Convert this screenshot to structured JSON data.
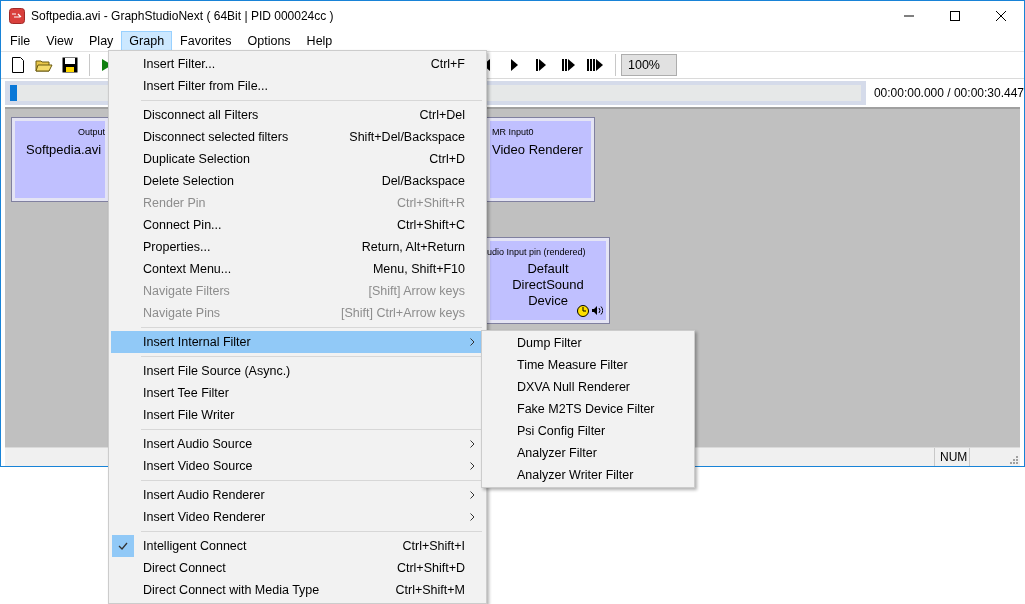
{
  "window": {
    "title": "Softpedia.avi - GraphStudioNext ( 64Bit | PID 000024cc )"
  },
  "menu_bar": [
    {
      "label": "File",
      "selected": false
    },
    {
      "label": "View",
      "selected": false
    },
    {
      "label": "Play",
      "selected": false
    },
    {
      "label": "Graph",
      "selected": true
    },
    {
      "label": "Favorites",
      "selected": false
    },
    {
      "label": "Options",
      "selected": false
    },
    {
      "label": "Help",
      "selected": false
    }
  ],
  "toolbar": {
    "zoom": "100%"
  },
  "seek_bar": {
    "level": 0.0,
    "time": "00:00:00.000 / 00:00:30.447"
  },
  "graph": {
    "filters": [
      {
        "kind": "source",
        "pin_label": "Output",
        "name": "Softpedia.avi",
        "clock": false
      },
      {
        "kind": "video",
        "pin_label": "MR Input0",
        "name": "Video Renderer",
        "clock": false
      },
      {
        "kind": "audio",
        "pin_label": "udio Input pin (rendered)",
        "name": "Default DirectSound Device",
        "clock": true
      }
    ]
  },
  "status_bar": {
    "num": "NUM"
  },
  "graph_menu": {
    "groups": [
      [
        {
          "label": "Insert Filter...",
          "shortcut": "Ctrl+F",
          "disabled": false,
          "checked": false,
          "selected": false,
          "submenu": false
        },
        {
          "label": "Insert Filter from File...",
          "disabled": false,
          "checked": false,
          "selected": false,
          "submenu": false
        }
      ],
      [
        {
          "label": "Disconnect all Filters",
          "shortcut": "Ctrl+Del",
          "disabled": false,
          "checked": false,
          "selected": false,
          "submenu": false
        },
        {
          "label": "Disconnect selected filters",
          "shortcut": "Shift+Del/Backspace",
          "disabled": false,
          "checked": false,
          "selected": false,
          "submenu": false
        },
        {
          "label": "Duplicate Selection",
          "shortcut": "Ctrl+D",
          "disabled": false,
          "checked": false,
          "selected": false,
          "submenu": false
        },
        {
          "label": "Delete Selection",
          "shortcut": "Del/Backspace",
          "disabled": false,
          "checked": false,
          "selected": false,
          "submenu": false
        },
        {
          "label": "Render Pin",
          "shortcut": "Ctrl+Shift+R",
          "disabled": true,
          "checked": false,
          "selected": false,
          "submenu": false
        },
        {
          "label": "Connect Pin...",
          "shortcut": "Ctrl+Shift+C",
          "disabled": false,
          "checked": false,
          "selected": false,
          "submenu": false
        },
        {
          "label": "Properties...",
          "shortcut": "Return, Alt+Return",
          "disabled": false,
          "checked": false,
          "selected": false,
          "submenu": false
        },
        {
          "label": "Context Menu...",
          "shortcut": "Menu, Shift+F10",
          "disabled": false,
          "checked": false,
          "selected": false,
          "submenu": false
        },
        {
          "label": "Navigate Filters",
          "shortcut": "[Shift] Arrow keys",
          "disabled": true,
          "checked": false,
          "selected": false,
          "submenu": false
        },
        {
          "label": "Navigate Pins",
          "shortcut": "[Shift] Ctrl+Arrow keys",
          "disabled": true,
          "checked": false,
          "selected": false,
          "submenu": false
        }
      ],
      [
        {
          "label": "Insert Internal Filter",
          "disabled": false,
          "checked": false,
          "selected": true,
          "submenu": true
        }
      ],
      [
        {
          "label": "Insert File Source (Async.)",
          "disabled": false,
          "checked": false,
          "selected": false,
          "submenu": false
        },
        {
          "label": "Insert Tee Filter",
          "disabled": false,
          "checked": false,
          "selected": false,
          "submenu": false
        },
        {
          "label": "Insert File Writer",
          "disabled": false,
          "checked": false,
          "selected": false,
          "submenu": false
        }
      ],
      [
        {
          "label": "Insert Audio Source",
          "disabled": false,
          "checked": false,
          "selected": false,
          "submenu": true
        },
        {
          "label": "Insert Video Source",
          "disabled": false,
          "checked": false,
          "selected": false,
          "submenu": true
        }
      ],
      [
        {
          "label": "Insert Audio Renderer",
          "disabled": false,
          "checked": false,
          "selected": false,
          "submenu": true
        },
        {
          "label": "Insert Video Renderer",
          "disabled": false,
          "checked": false,
          "selected": false,
          "submenu": true
        }
      ],
      [
        {
          "label": "Intelligent Connect",
          "shortcut": "Ctrl+Shift+I",
          "disabled": false,
          "checked": true,
          "selected": false,
          "submenu": false
        },
        {
          "label": "Direct Connect",
          "shortcut": "Ctrl+Shift+D",
          "disabled": false,
          "checked": false,
          "selected": false,
          "submenu": false
        },
        {
          "label": "Direct Connect with Media Type",
          "shortcut": "Ctrl+Shift+M",
          "disabled": false,
          "checked": false,
          "selected": false,
          "submenu": false
        }
      ]
    ]
  },
  "internal_filter_submenu": [
    {
      "label": "Dump Filter"
    },
    {
      "label": "Time Measure Filter"
    },
    {
      "label": "DXVA Null Renderer"
    },
    {
      "label": "Fake M2TS Device Filter"
    },
    {
      "label": "Psi Config Filter"
    },
    {
      "label": "Analyzer Filter"
    },
    {
      "label": "Analyzer Writer Filter"
    }
  ]
}
